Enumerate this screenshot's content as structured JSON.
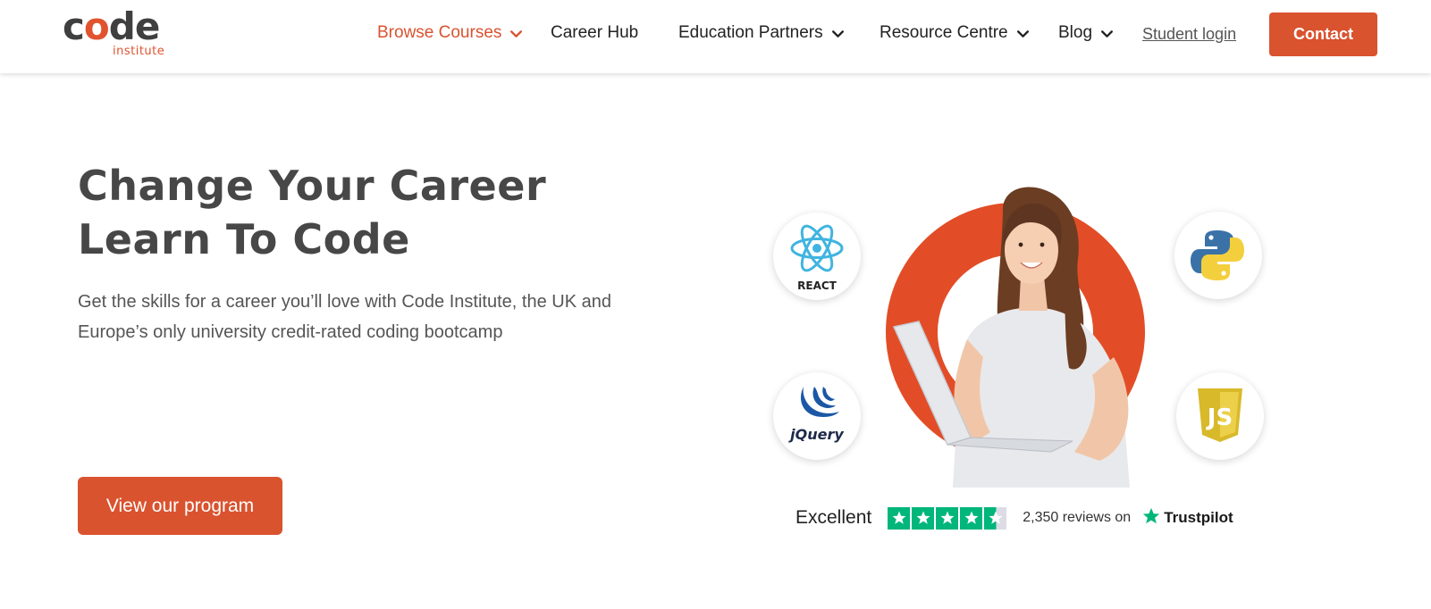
{
  "header": {
    "logo": {
      "main_pre": "c",
      "main_o": "o",
      "main_post": "de",
      "sub": "institute"
    },
    "nav": [
      {
        "label": "Browse Courses",
        "dropdown": true,
        "active": true
      },
      {
        "label": "Career Hub",
        "dropdown": false
      },
      {
        "label": "Education Partners",
        "dropdown": true
      },
      {
        "label": "Resource Centre",
        "dropdown": true
      },
      {
        "label": "Blog",
        "dropdown": true
      }
    ],
    "student_login": "Student login",
    "contact": "Contact"
  },
  "hero": {
    "title_line1": "Change Your Career",
    "title_line2": "Learn To Code",
    "description": "Get the skills for a career you’ll love with Code Institute, the UK and Europe’s only university credit-rated coding bootcamp",
    "cta": "View our program"
  },
  "badges": {
    "react": "REACT",
    "jquery": "jQuery",
    "python": "python-icon",
    "js": "JS"
  },
  "trustpilot": {
    "rating_text": "Excellent",
    "stars": 4.5,
    "reviews_text": "2,350 reviews on",
    "brand": "Trustpilot"
  },
  "colors": {
    "brand_orange": "#d9532f",
    "trust_green": "#00b67a",
    "text_dark": "#474747"
  }
}
